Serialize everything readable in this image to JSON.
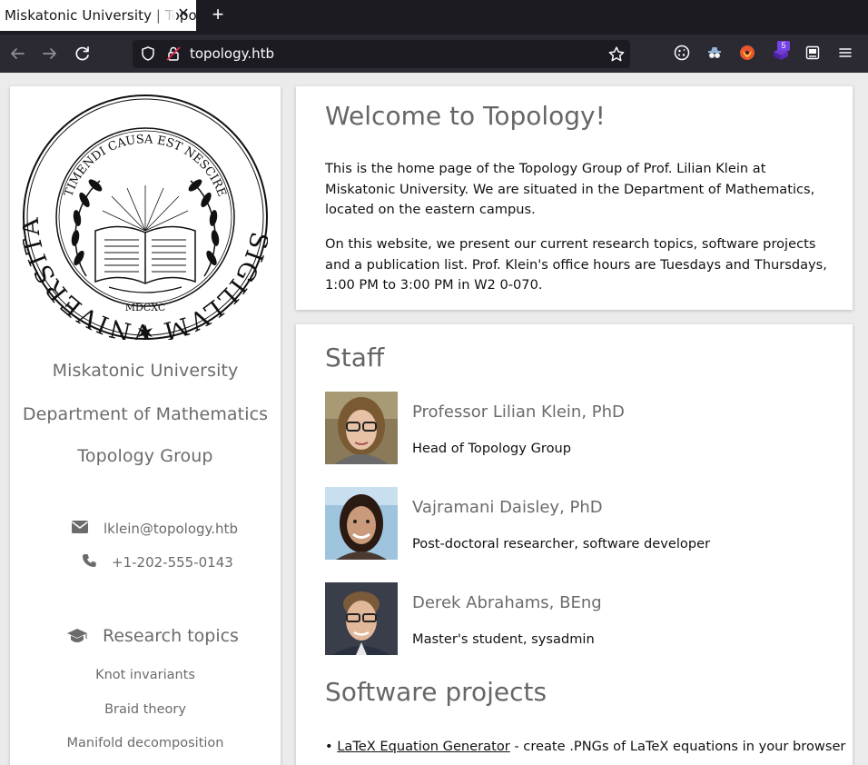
{
  "browser": {
    "tab_title": "Miskatonic University | Topology Group",
    "url": "topology.htb",
    "extension_badge": "5"
  },
  "sidebar": {
    "university": "Miskatonic University",
    "department": "Department of Mathematics",
    "group": "Topology Group",
    "email": "lklein@topology.htb",
    "phone": "+1-202-555-0143",
    "topics_heading": "Research topics",
    "topics": [
      "Knot invariants",
      "Braid theory",
      "Manifold decomposition"
    ]
  },
  "seal": {
    "outer_text": "SIGILLVM VNIVERSITATIS MISKATONICIENSIS",
    "inner_text": "TIMENDI CAUSA EST NESCIRE",
    "year": "MDCXC"
  },
  "welcome": {
    "title": "Welcome to Topology!",
    "p1": "This is the home page of the Topology Group of Prof. Lilian Klein at Miskatonic University. We are situated in the Department of Mathematics, located on the eastern campus.",
    "p2": "On this website, we present our current research topics, software projects and a publication list. Prof. Klein's office hours are Tuesdays and Thursdays, 1:00 PM to 3:00 PM in W2 0-070."
  },
  "staff": {
    "title": "Staff",
    "members": [
      {
        "name": "Professor Lilian Klein, PhD",
        "role": "Head of Topology Group"
      },
      {
        "name": "Vajramani Daisley, PhD",
        "role": "Post-doctoral researcher, software developer"
      },
      {
        "name": "Derek Abrahams, BEng",
        "role": "Master's student, sysadmin"
      }
    ]
  },
  "software": {
    "title": "Software projects",
    "items": [
      {
        "bullet": "•",
        "link": "LaTeX Equation Generator",
        "desc": " - create .PNGs of LaTeX equations in your browser"
      }
    ]
  }
}
